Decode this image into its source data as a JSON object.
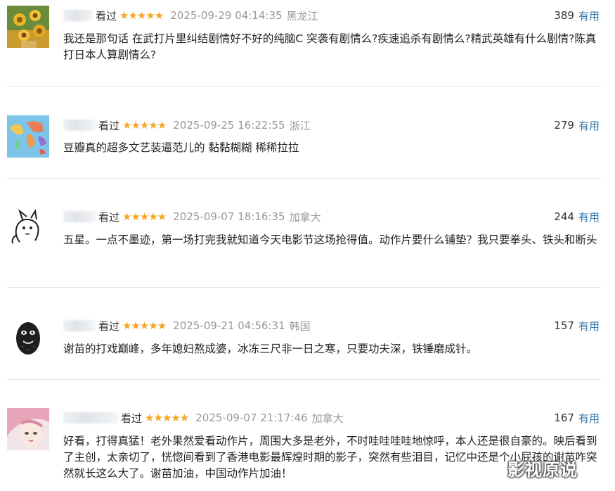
{
  "comments": [
    {
      "watched": "看过",
      "stars": "★★★★★",
      "time": "2025-09-29 04:14:35",
      "location": "黑龙江",
      "useful_count": "389",
      "useful_label": "有用",
      "text": "我还是那句话 在武打片里纠结剧情好不好的纯脑C 突袭有剧情么?疾速追杀有剧情么?精武英雄有什么剧情?陈真打日本人算剧情么?"
    },
    {
      "watched": "看过",
      "stars": "★★★★★",
      "time": "2025-09-25 16:22:55",
      "location": "浙江",
      "useful_count": "279",
      "useful_label": "有用",
      "text": "豆瓣真的超多文艺装逼范儿的 黏黏糊糊 稀稀拉拉"
    },
    {
      "watched": "看过",
      "stars": "★★★★★",
      "time": "2025-09-07 18:16:35",
      "location": "加拿大",
      "useful_count": "244",
      "useful_label": "有用",
      "text": "五星。一点不墨迹，第一场打完我就知道今天电影节这场抢得值。动作片要什么铺垫？我只要拳头、铁头和断头"
    },
    {
      "watched": "看过",
      "stars": "★★★★★",
      "time": "2025-09-21 04:56:31",
      "location": "韩国",
      "useful_count": "157",
      "useful_label": "有用",
      "text": "谢苗的打戏巅峰，多年媳妇熬成婆，冰冻三尺非一日之寒，只要功夫深，铁锤磨成针。"
    },
    {
      "watched": "看过",
      "stars": "★★★★★",
      "time": "2025-09-07 21:17:46",
      "location": "加拿大",
      "useful_count": "167",
      "useful_label": "有用",
      "text": "好看，打得真猛！老外果然爱看动作片，周围大多是老外，不时哇哇哇哇地惊呼，本人还是很自豪的。映后看到了主创，太亲切了，恍惚间看到了香港电影最辉煌时期的影子，突然有些泪目，记忆中还是个小屁孩的谢苗咋突然就长这么大了。谢苗加油，中国动作片加油！"
    }
  ],
  "watermark": "影视原说",
  "colors": {
    "star": "#f5a623",
    "link": "#3377aa",
    "muted": "#999999"
  }
}
